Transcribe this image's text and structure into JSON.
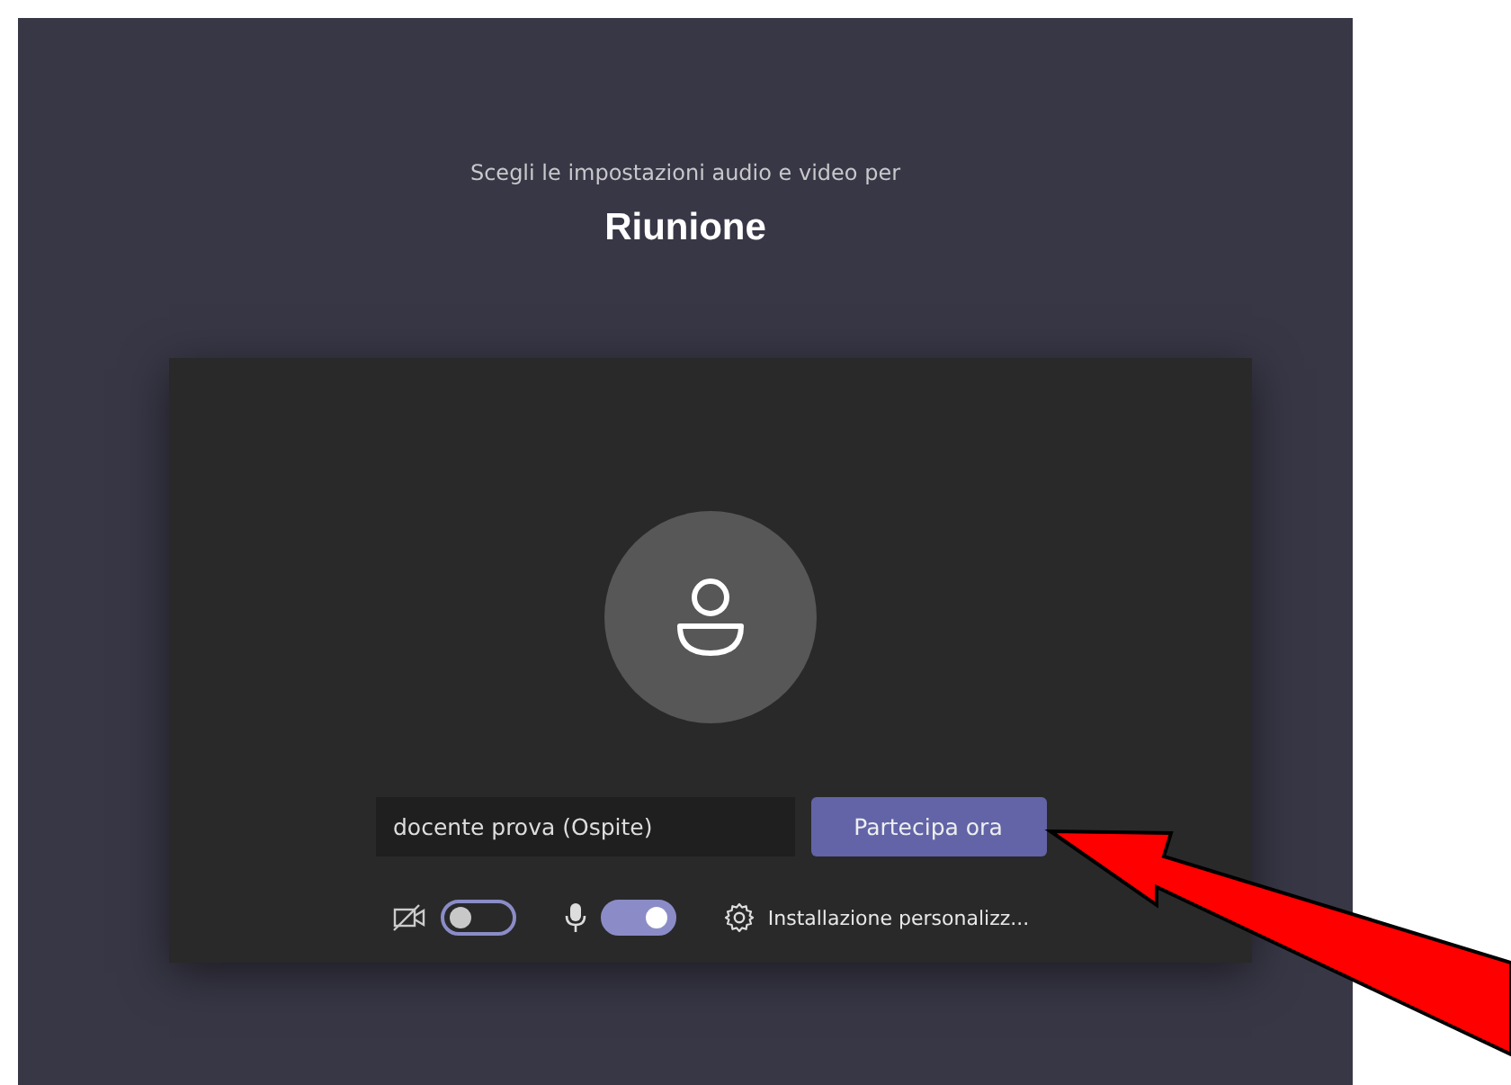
{
  "prompt": "Scegli le impostazioni audio e video per",
  "meeting_title": "Riunione",
  "name_field": {
    "value": "docente prova (Ospite)"
  },
  "join_button": "Partecipa ora",
  "toggles": [
    {
      "kind": "camera",
      "on": false
    },
    {
      "kind": "mic",
      "on": true
    }
  ],
  "settings_link": "Installazione personalizz..."
}
